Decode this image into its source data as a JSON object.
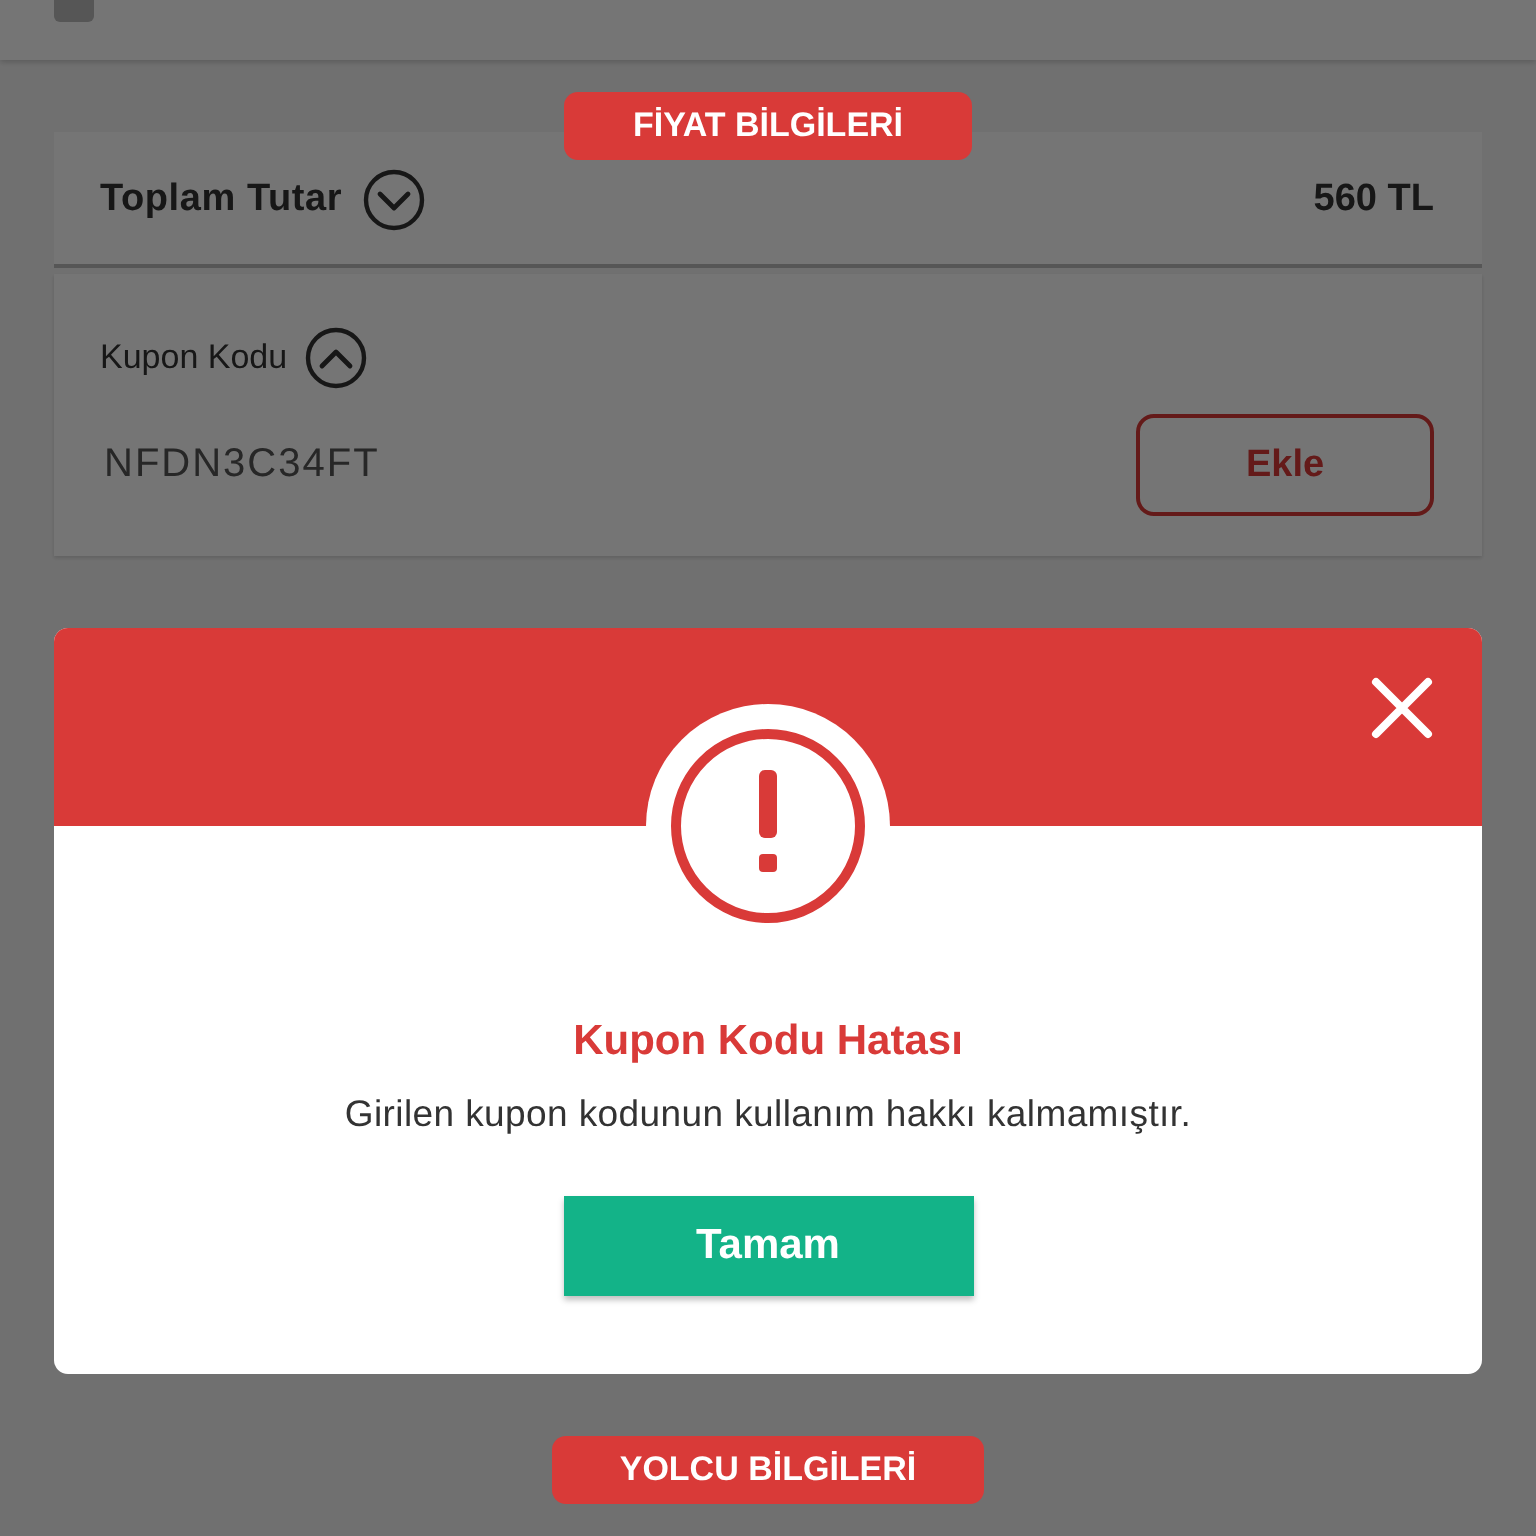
{
  "passenger": {
    "checked": false
  },
  "price_section": {
    "heading": "FİYAT BİLGİLERİ",
    "total_label": "Toplam Tutar",
    "total_value": "560 TL",
    "total_expanded": false,
    "coupon_label": "Kupon Kodu",
    "coupon_expanded": true,
    "coupon_value": "NFDN3C34FT",
    "add_button": "Ekle"
  },
  "dialog": {
    "title": "Kupon Kodu Hatası",
    "message": "Girilen kupon kodunun kullanım hakkı kalmamıştır.",
    "ok_button": "Tamam"
  },
  "next_section": {
    "heading": "YOLCU BİLGİLERİ"
  }
}
